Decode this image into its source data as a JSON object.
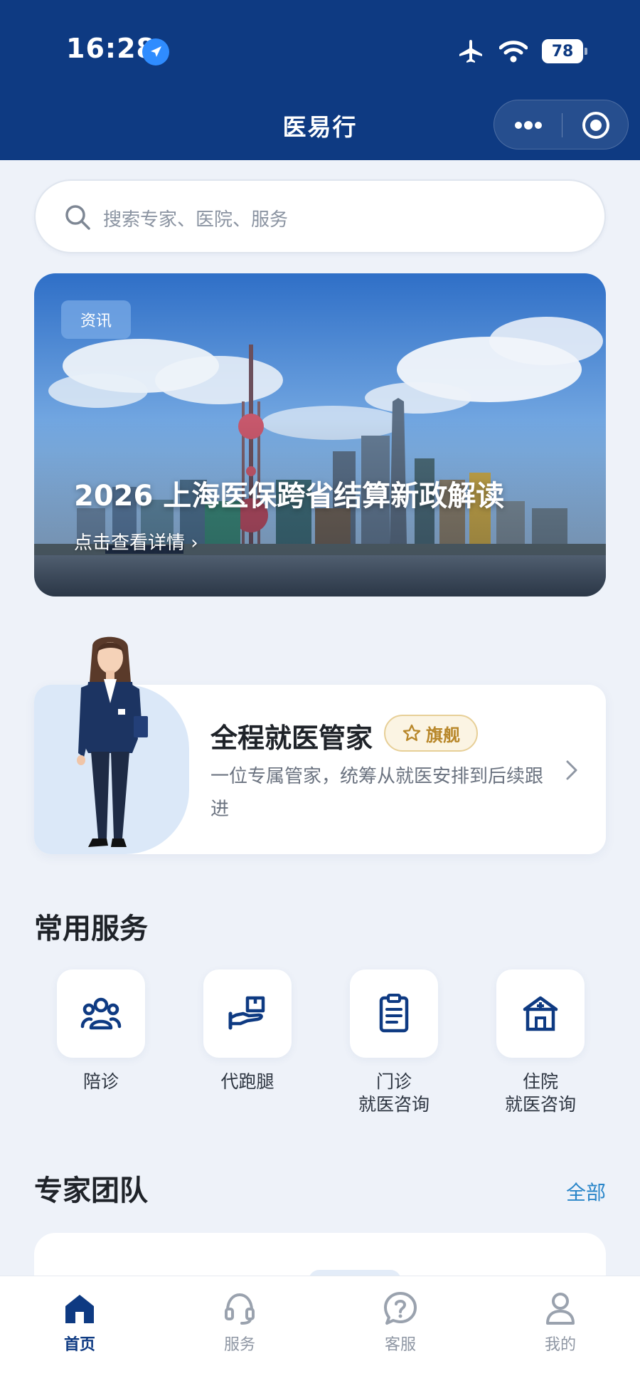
{
  "status_bar": {
    "time": "16:28",
    "battery": "78"
  },
  "nav": {
    "title": "医易行"
  },
  "search": {
    "placeholder": "搜索专家、医院、服务"
  },
  "banner": {
    "tag": "资讯",
    "headline": "2026 上海医保跨省结算新政解读",
    "sub": "点击查看详情 ›"
  },
  "butler": {
    "title": "全程就医管家",
    "badge": "旗舰",
    "desc": "一位专属管家，统筹从就医安排到后续跟进"
  },
  "services": {
    "title": "常用服务",
    "items": [
      {
        "label": "陪诊",
        "icon": "people-icon"
      },
      {
        "label": "代跑腿",
        "icon": "hand-package-icon"
      },
      {
        "label": "门诊\n就医咨询",
        "icon": "clipboard-icon"
      },
      {
        "label": "住院\n就医咨询",
        "icon": "hospital-icon"
      }
    ]
  },
  "experts": {
    "title": "专家团队",
    "link": "全部"
  },
  "tabbar": {
    "items": [
      {
        "label": "首页",
        "icon": "home-icon",
        "active": true
      },
      {
        "label": "服务",
        "icon": "headset-icon",
        "active": false
      },
      {
        "label": "客服",
        "icon": "help-icon",
        "active": false
      },
      {
        "label": "我的",
        "icon": "user-icon",
        "active": false
      }
    ]
  },
  "colors": {
    "primary": "#0e3a82",
    "accent_link": "#2a86c9",
    "badge_gold": "#b8872a"
  }
}
